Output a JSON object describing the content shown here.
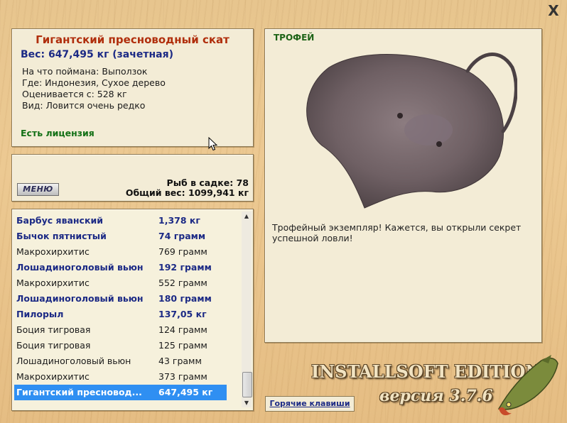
{
  "window": {
    "close_label": "X"
  },
  "fish_info": {
    "title": "Гигантский пресноводный скат",
    "weight_line": "Вес: 647,495 кг (зачетная)",
    "caught_on": "На что поймана: Выползок",
    "location": "Где: Индонезия, Сухое дерево",
    "value": "Оценивается с: 528 кг",
    "rarity": "Вид: Ловится очень редко",
    "license": "Есть лицензия"
  },
  "status": {
    "menu_label": "МЕНЮ",
    "fish_count": "Рыб в садке: 78",
    "total_weight": "Общий вес: 1099,941 кг"
  },
  "catch_list": [
    {
      "name": "Барбус яванский",
      "weight": "1,378 кг",
      "style": "bold"
    },
    {
      "name": "Бычок пятнистый",
      "weight": "74 грамм",
      "style": "bold"
    },
    {
      "name": "Макрохирхитис",
      "weight": "769 грамм",
      "style": "plain"
    },
    {
      "name": "Лошадиноголовый вьюн",
      "weight": "192 грамм",
      "style": "bold"
    },
    {
      "name": "Макрохирхитис",
      "weight": "552 грамм",
      "style": "plain"
    },
    {
      "name": "Лошадиноголовый вьюн",
      "weight": "180 грамм",
      "style": "bold"
    },
    {
      "name": "Пилорыл",
      "weight": "137,05 кг",
      "style": "bold"
    },
    {
      "name": "Боция тигровая",
      "weight": "124 грамм",
      "style": "plain"
    },
    {
      "name": "Боция тигровая",
      "weight": "125 грамм",
      "style": "plain"
    },
    {
      "name": "Лошадиноголовый вьюн",
      "weight": "43 грамм",
      "style": "plain"
    },
    {
      "name": "Макрохирхитис",
      "weight": "373 грамм",
      "style": "plain"
    },
    {
      "name": "Гигантский пресновод...",
      "weight": "647,495 кг",
      "style": "sel"
    }
  ],
  "trophy": {
    "label": "ТРОФЕЙ",
    "description": "Трофейный экземпляр! Кажется, вы открыли секрет успешной ловли!"
  },
  "footer": {
    "hotkeys_label": "Горячие клавиши",
    "brand": "INSTALLSOFT EDITION",
    "version": "версия 3.7.6"
  },
  "colors": {
    "title": "#b02e0c",
    "weight": "#1c2a85",
    "license": "#137016",
    "selection": "#2f8ff2"
  }
}
